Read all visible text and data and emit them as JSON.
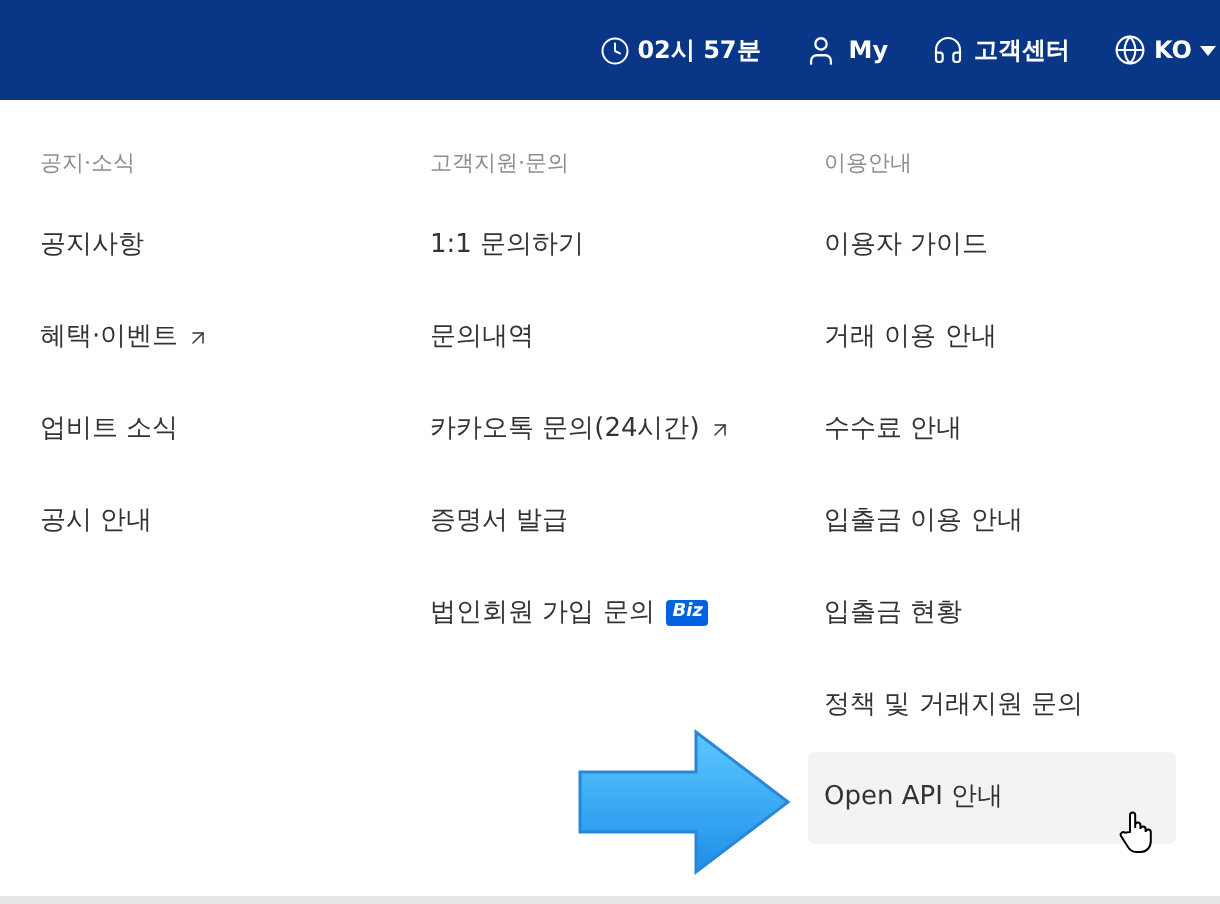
{
  "header": {
    "time": "02시 57분",
    "my": "My",
    "support": "고객센터",
    "language": "KO"
  },
  "columns": [
    {
      "heading": "공지·소식",
      "items": [
        {
          "label": "공지사항",
          "external": false,
          "highlighted": false
        },
        {
          "label": "혜택·이벤트",
          "external": true,
          "highlighted": false
        },
        {
          "label": "업비트 소식",
          "external": false,
          "highlighted": false
        },
        {
          "label": "공시 안내",
          "external": false,
          "highlighted": false
        }
      ]
    },
    {
      "heading": "고객지원·문의",
      "items": [
        {
          "label": "1:1 문의하기",
          "external": false,
          "highlighted": false
        },
        {
          "label": "문의내역",
          "external": false,
          "highlighted": false
        },
        {
          "label": "카카오톡 문의(24시간)",
          "external": true,
          "highlighted": false
        },
        {
          "label": "증명서 발급",
          "external": false,
          "highlighted": false
        },
        {
          "label": "법인회원 가입 문의",
          "external": false,
          "highlighted": false,
          "badge": "Biz"
        }
      ]
    },
    {
      "heading": "이용안내",
      "items": [
        {
          "label": "이용자 가이드",
          "external": false,
          "highlighted": false
        },
        {
          "label": "거래 이용 안내",
          "external": false,
          "highlighted": false
        },
        {
          "label": "수수료 안내",
          "external": false,
          "highlighted": false
        },
        {
          "label": "입출금 이용 안내",
          "external": false,
          "highlighted": false
        },
        {
          "label": "입출금 현황",
          "external": false,
          "highlighted": false
        },
        {
          "label": "정책 및 거래지원 문의",
          "external": false,
          "highlighted": false
        },
        {
          "label": "Open API 안내",
          "external": false,
          "highlighted": true
        }
      ]
    }
  ]
}
